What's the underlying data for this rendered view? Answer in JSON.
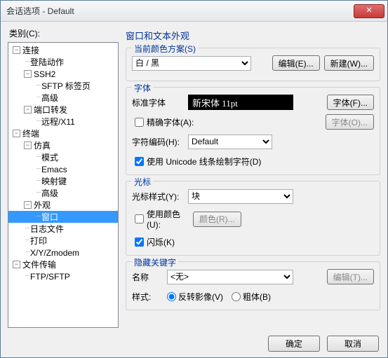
{
  "title": "会话选项 - Default",
  "category_label": "类别(C):",
  "tree": {
    "n0": "连接",
    "n1": "登陆动作",
    "n2": "SSH2",
    "n3": "SFTP 标签页",
    "n4": "高级",
    "n5": "端口转发",
    "n6": "远程/X11",
    "n7": "终端",
    "n8": "仿真",
    "n9": "模式",
    "n10": "Emacs",
    "n11": "映射键",
    "n12": "高级",
    "n13": "外观",
    "n14": "窗口",
    "n15": "日志文件",
    "n16": "打印",
    "n17": "X/Y/Zmodem",
    "n18": "文件传输",
    "n19": "FTP/SFTP"
  },
  "panel_title": "窗口和文本外观",
  "scheme": {
    "group": "当前颜色方案(S)",
    "value": "白 / 黑",
    "edit": "编辑(E)...",
    "new": "新建(W)..."
  },
  "font": {
    "group": "字体",
    "std_label": "标准字体",
    "preview": "新宋体  11pt",
    "btn": "字体(F)...",
    "precise": "精确字体(A):",
    "narrow_btn": "字体(O)...",
    "enc_label": "字符编码(H):",
    "enc_value": "Default",
    "unicode": "使用 Unicode 线条绘制字符(D)"
  },
  "cursor": {
    "group": "光标",
    "style_label": "光标样式(Y):",
    "style_value": "块",
    "usecolor": "使用颜色(U):",
    "color_btn": "颜色(R)...",
    "blink": "闪烁(K)"
  },
  "hidden": {
    "group": "隐藏关键字",
    "name_label": "名称",
    "name_value": "<无>",
    "edit": "编辑(T)...",
    "style_label": "样式:",
    "r1": "反转影像(V)",
    "r2": "粗体(B)"
  },
  "buttons": {
    "ok": "确定",
    "cancel": "取消"
  }
}
